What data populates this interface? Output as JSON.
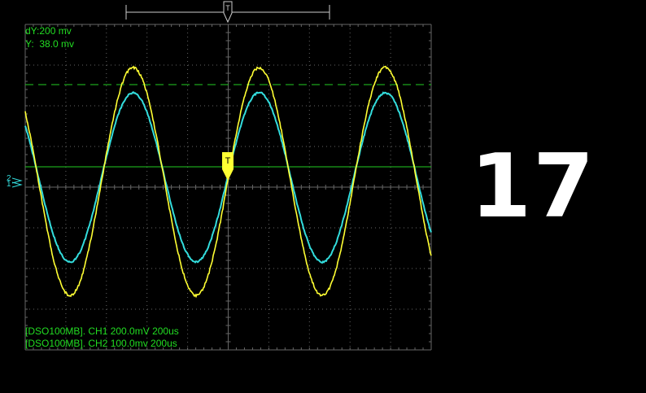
{
  "cursor": {
    "dy_readout": "dY:200 mv",
    "y_readout": "Y:  38.0 mv"
  },
  "channels": {
    "ch1_info": "[DSO100MB]. CH1 200.0mV 200us",
    "ch2_info": "[DSO100MB]. CH2 100.0mv 200us",
    "ch1_color": "#ffff33",
    "ch2_color": "#33dddd"
  },
  "markers": {
    "ch2_label": "2",
    "ch1_label": "1",
    "trigger_label": "T"
  },
  "overlay": {
    "big_number": "17"
  },
  "colors": {
    "grid": "#666666",
    "cursor_line": "#22cc22",
    "readout_text": "#22dd22"
  }
}
